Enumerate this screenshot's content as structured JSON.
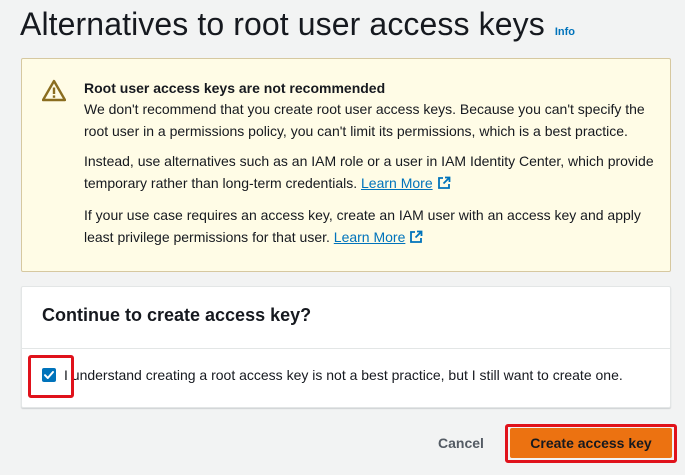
{
  "page": {
    "title": "Alternatives to root user access keys",
    "info_link": "Info"
  },
  "alert": {
    "type": "warning",
    "icon": "warning-triangle-icon",
    "title": "Root user access keys are not recommended",
    "para1": "We don't recommend that you create root user access keys. Because you can't specify the root user in a permissions policy, you can't limit its permissions, which is a best practice.",
    "para2": "Instead, use alternatives such as an IAM role or a user in IAM Identity Center, which provide temporary rather than long-term credentials.",
    "para2_link": "Learn More",
    "para3": "If your use case requires an access key, create an IAM user with an access key and apply least privilege permissions for that user.",
    "para3_link": "Learn More"
  },
  "confirm": {
    "title": "Continue to create access key?",
    "checkbox_label": "I understand creating a root access key is not a best practice, but I still want to create one.",
    "checked": true
  },
  "actions": {
    "cancel_label": "Cancel",
    "create_label": "Create access key"
  },
  "colors": {
    "accent": "#ec7211",
    "link": "#0073bb",
    "highlight": "#e0121b",
    "warning_bg": "#fffce6"
  }
}
